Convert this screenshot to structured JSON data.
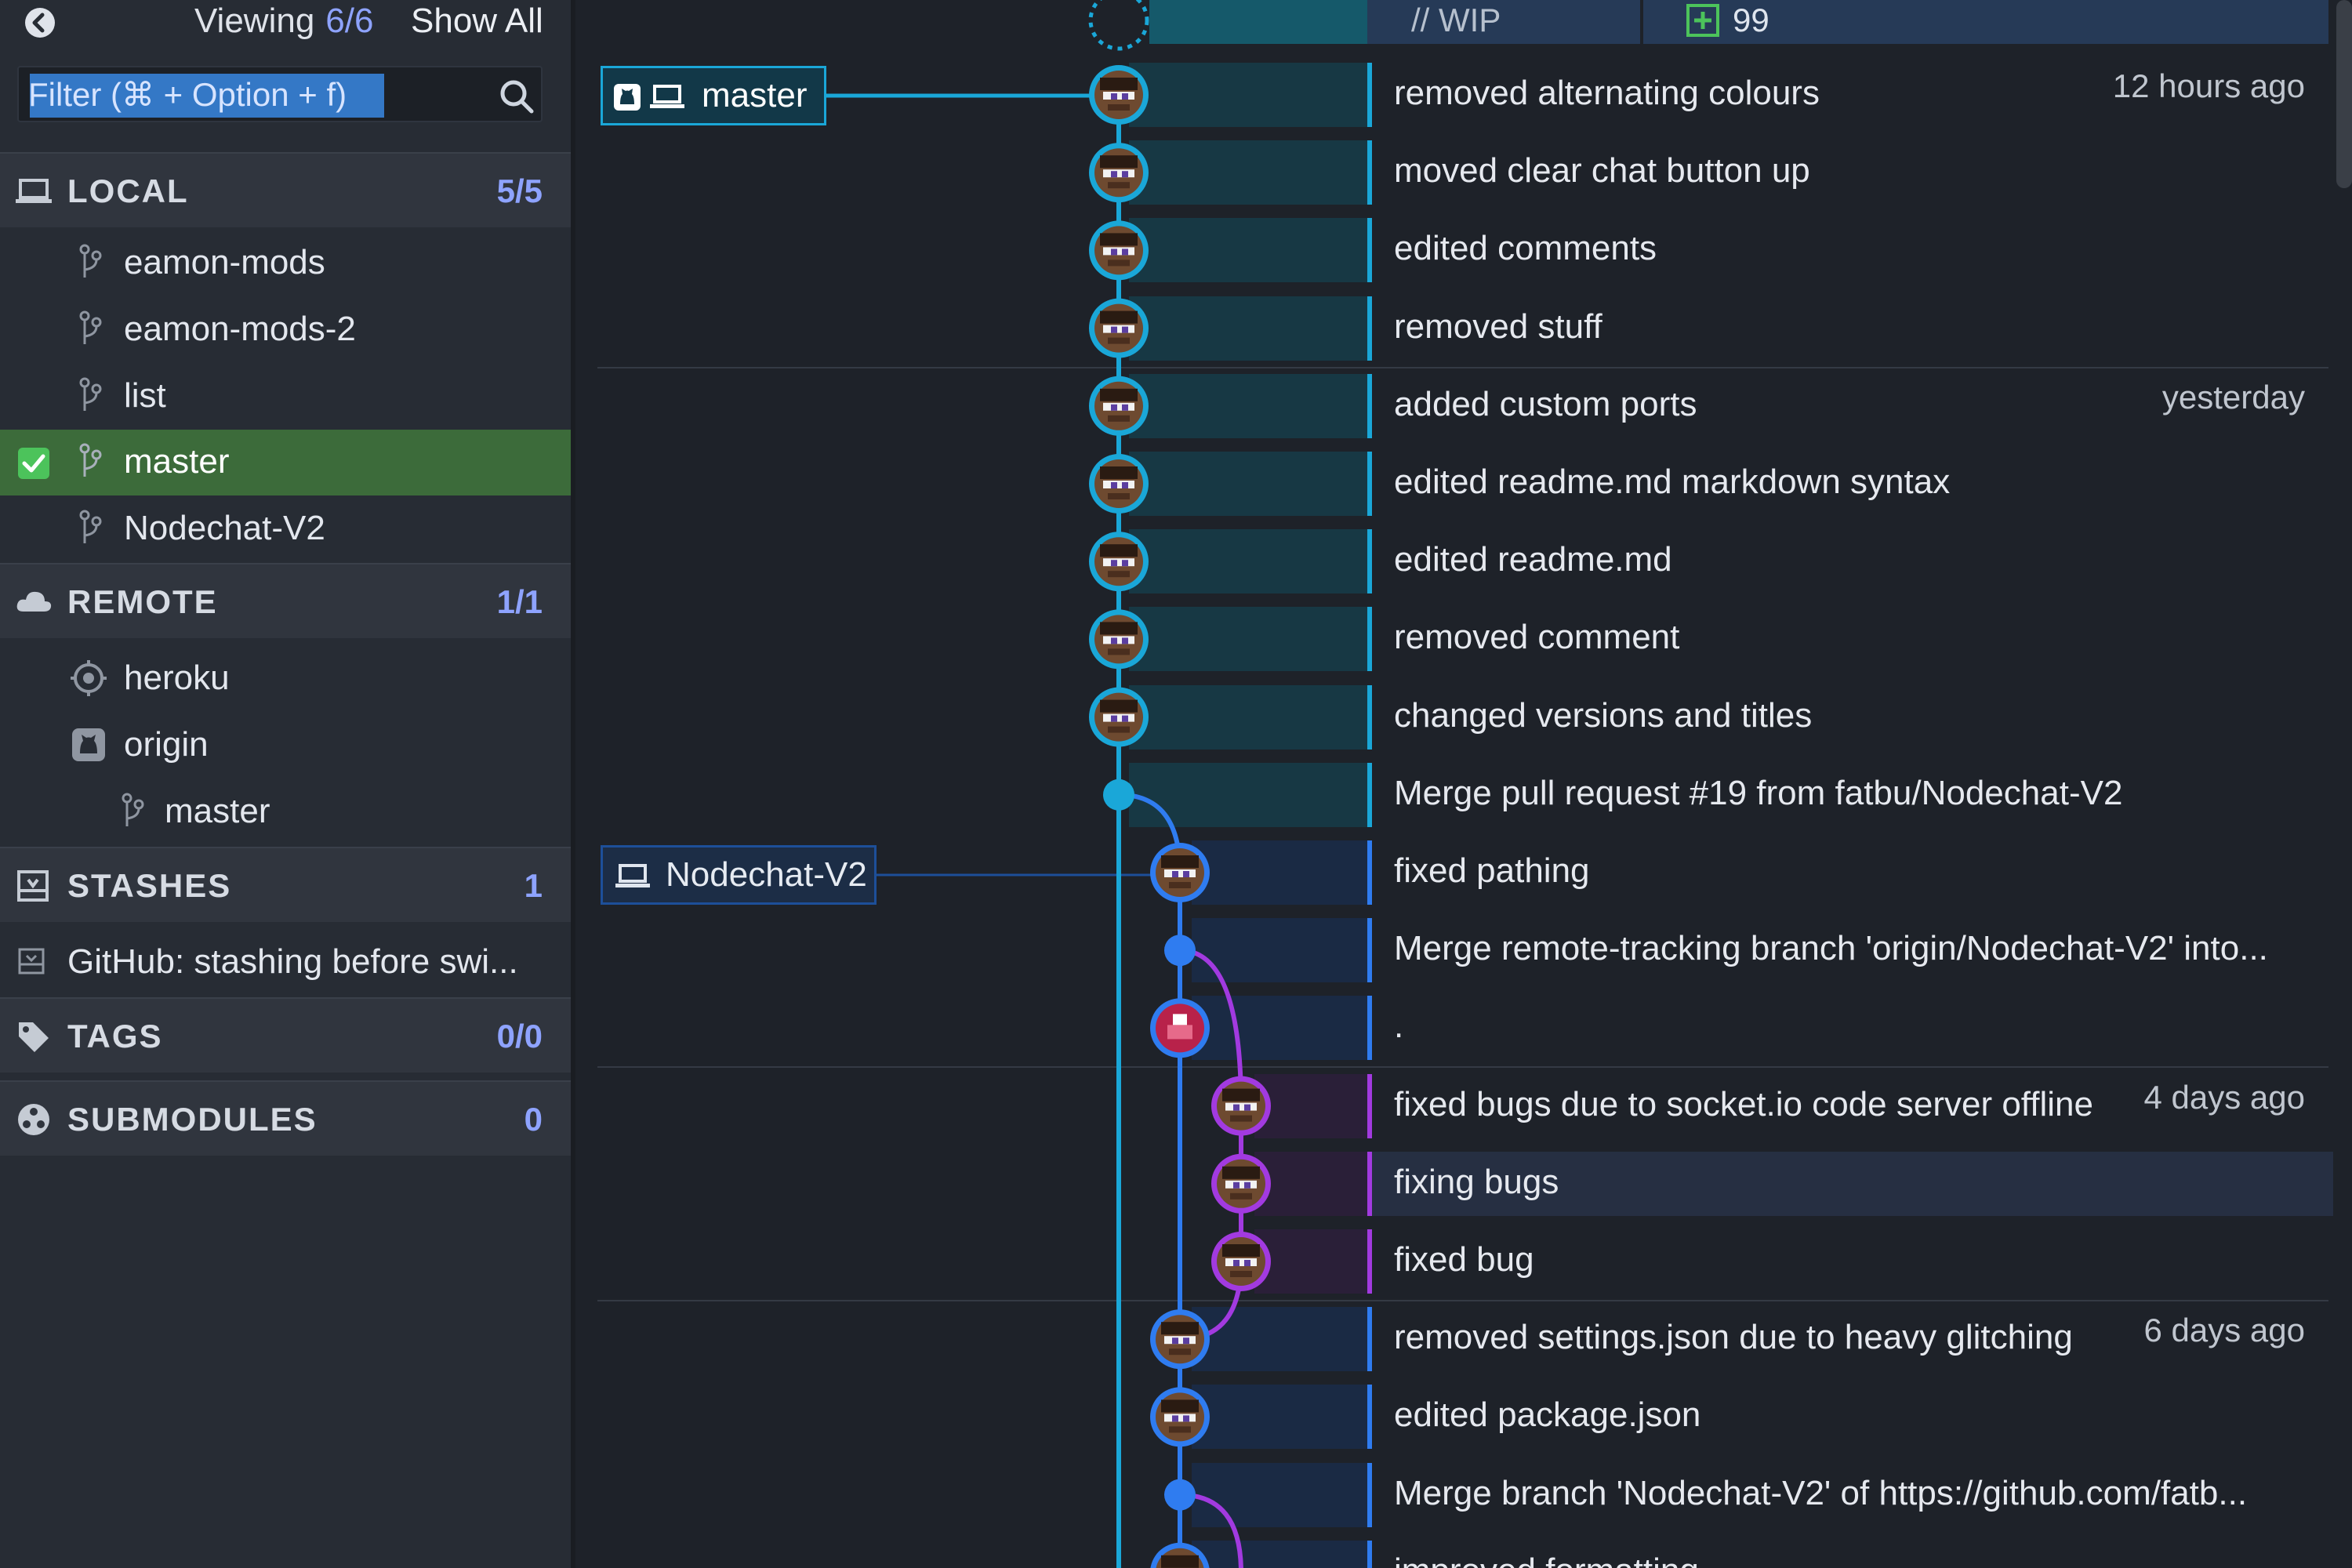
{
  "toolbar": {
    "viewing_label": "Viewing",
    "viewing_count": "6/6",
    "show_all_label": "Show All"
  },
  "filter": {
    "placeholder": "Filter (⌘ + Option + f)"
  },
  "sections": {
    "local": {
      "title": "LOCAL",
      "count": "5/5"
    },
    "remote": {
      "title": "REMOTE",
      "count": "1/1"
    },
    "stashes": {
      "title": "STASHES",
      "count": "1"
    },
    "tags": {
      "title": "TAGS",
      "count": "0/0"
    },
    "submodules": {
      "title": "SUBMODULES",
      "count": "0"
    }
  },
  "local_branches": [
    "eamon-mods",
    "eamon-mods-2",
    "list",
    "master",
    "Nodechat-V2"
  ],
  "remotes": {
    "heroku": "heroku",
    "origin": "origin",
    "origin_master": "master"
  },
  "stashes": [
    "GitHub: stashing before swi..."
  ],
  "wip": {
    "label": "// WIP",
    "count": "99"
  },
  "refs": {
    "master": "master",
    "nodechat": "Nodechat-V2"
  },
  "commits": [
    {
      "message": "removed alternating colours",
      "time": "12 hours ago"
    },
    {
      "message": "moved clear chat button up",
      "time": ""
    },
    {
      "message": "edited comments",
      "time": ""
    },
    {
      "message": "removed stuff",
      "time": ""
    },
    {
      "message": "added custom ports",
      "time": "yesterday"
    },
    {
      "message": "edited readme.md markdown syntax",
      "time": ""
    },
    {
      "message": "edited readme.md",
      "time": ""
    },
    {
      "message": "removed comment",
      "time": ""
    },
    {
      "message": "changed versions and titles",
      "time": ""
    },
    {
      "message": "Merge pull request #19 from fatbu/Nodechat-V2",
      "time": ""
    },
    {
      "message": "fixed pathing",
      "time": ""
    },
    {
      "message": "Merge remote-tracking branch 'origin/Nodechat-V2' into...",
      "time": ""
    },
    {
      "message": ".",
      "time": ""
    },
    {
      "message": "fixed bugs due to socket.io code server offline",
      "time": "4 days ago"
    },
    {
      "message": "fixing bugs",
      "time": ""
    },
    {
      "message": "fixed bug",
      "time": ""
    },
    {
      "message": "removed settings.json due to heavy glitching",
      "time": "6 days ago"
    },
    {
      "message": "edited package.json",
      "time": ""
    },
    {
      "message": "Merge branch 'Nodechat-V2' of https://github.com/fatb...",
      "time": ""
    },
    {
      "message": "improved formatting",
      "time": ""
    }
  ],
  "colors": {
    "lane_master": "#1aa7d8",
    "lane_nodechat": "#2f7cf0",
    "lane_feature": "#a23ae0",
    "active_branch_bg": "#3c6b3a",
    "accent_count": "#8ea3ff"
  }
}
